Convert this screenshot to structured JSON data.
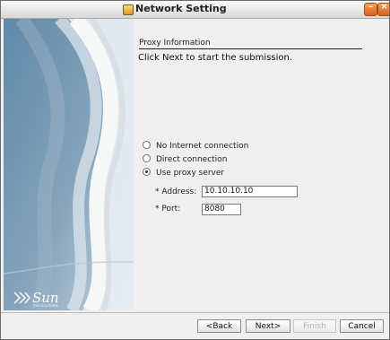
{
  "window": {
    "title": "Network Setting",
    "icon": "network-icon",
    "colors": {
      "titlebar_button": "#e57a2f",
      "left_panel": "#8aa7be"
    }
  },
  "branding": {
    "logo": "Sun",
    "tagline": "microsystems"
  },
  "section": {
    "title": "Proxy Information",
    "instruction": "Click Next to start the submission."
  },
  "options": [
    {
      "label": "No Internet connection",
      "selected": false
    },
    {
      "label": "Direct connection",
      "selected": false
    },
    {
      "label": "Use proxy server",
      "selected": true
    }
  ],
  "proxy": {
    "address_label": "* Address:",
    "address_value": "10.10.10.10",
    "port_label": "* Port:",
    "port_value": "8080"
  },
  "buttons": {
    "back": "<Back",
    "next": "Next>",
    "finish": "Finish",
    "cancel": "Cancel"
  }
}
